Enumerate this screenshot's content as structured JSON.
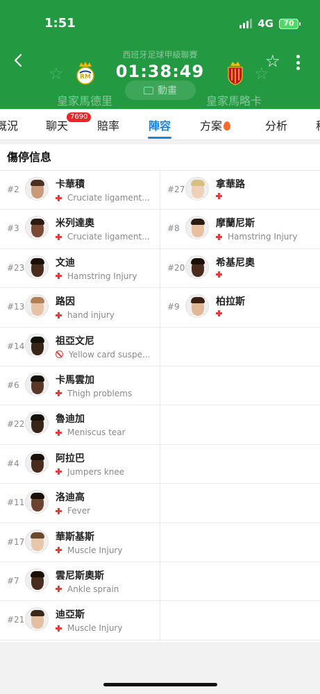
{
  "status": {
    "time": "1:51",
    "network": "4G",
    "battery": "70"
  },
  "match": {
    "league": "西班牙足球甲級聯賽",
    "timer": "01:38:49",
    "home_team": "皇家馬德里",
    "away_team": "皇家馬略卡",
    "animation_label": "動畫"
  },
  "tabs": [
    {
      "label": "概況"
    },
    {
      "label": "聊天",
      "badge": "7690"
    },
    {
      "label": "賠率"
    },
    {
      "label": "陣容"
    },
    {
      "label": "方案"
    },
    {
      "label": "分析"
    }
  ],
  "section": {
    "title": "傷停信息"
  },
  "injuries": {
    "home": [
      {
        "number": "#2",
        "name": "卡華積",
        "type": "injury",
        "reason": "Cruciate ligament..."
      },
      {
        "number": "#3",
        "name": "米列達奧",
        "type": "injury",
        "reason": "Cruciate ligament..."
      },
      {
        "number": "#23",
        "name": "文迪",
        "type": "injury",
        "reason": "Hamstring Injury"
      },
      {
        "number": "#13",
        "name": "路因",
        "type": "injury",
        "reason": "hand injury"
      },
      {
        "number": "#14",
        "name": "祖亞文尼",
        "type": "suspension",
        "reason": "Yellow card suspe..."
      },
      {
        "number": "#6",
        "name": "卡馬雲加",
        "type": "injury",
        "reason": "Thigh problems"
      },
      {
        "number": "#22",
        "name": "魯迪加",
        "type": "injury",
        "reason": "Meniscus tear"
      },
      {
        "number": "#4",
        "name": "阿拉巴",
        "type": "injury",
        "reason": "Jumpers knee"
      },
      {
        "number": "#11",
        "name": "洛迪高",
        "type": "injury",
        "reason": "Fever"
      },
      {
        "number": "#17",
        "name": "華斯基斯",
        "type": "injury",
        "reason": "Muscle Injury"
      },
      {
        "number": "#7",
        "name": "雲尼斯奧斯",
        "type": "injury",
        "reason": "Ankle sprain"
      },
      {
        "number": "#21",
        "name": "迪亞斯",
        "type": "injury",
        "reason": "Muscle Injury"
      }
    ],
    "away": [
      {
        "number": "#27",
        "name": "拿華路",
        "type": "injury",
        "reason": ""
      },
      {
        "number": "#8",
        "name": "摩蘭尼斯",
        "type": "injury",
        "reason": "Hamstring Injury"
      },
      {
        "number": "#20",
        "name": "希基尼奧",
        "type": "injury",
        "reason": ""
      },
      {
        "number": "#9",
        "name": "柏拉斯",
        "type": "injury",
        "reason": ""
      }
    ]
  },
  "colors": {
    "header_green": "#239a42",
    "accent_blue": "#1683e0",
    "injury_red": "#e33a3a"
  }
}
